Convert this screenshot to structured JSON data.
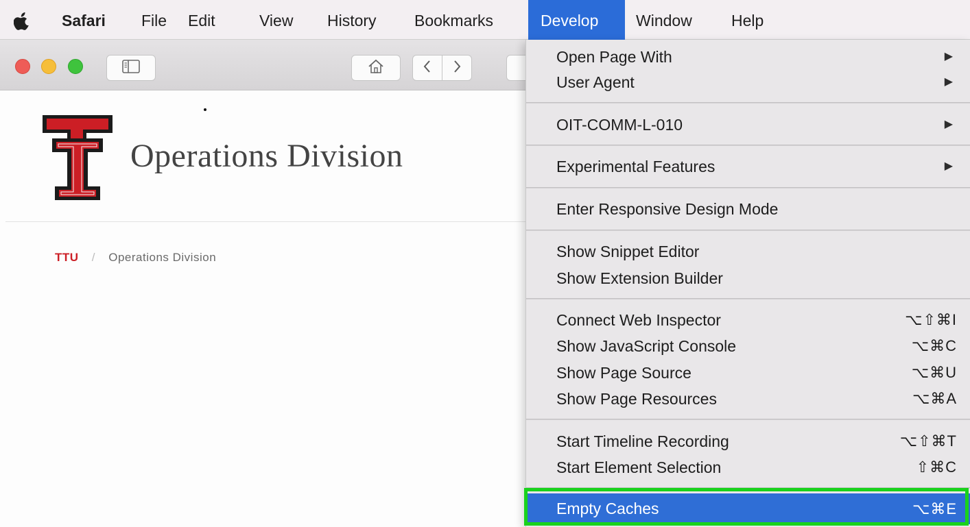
{
  "menubar": {
    "items": [
      "Safari",
      "File",
      "Edit",
      "View",
      "History",
      "Bookmarks",
      "Develop",
      "Window",
      "Help"
    ]
  },
  "page": {
    "title": "Operations Division",
    "breadcrumb": {
      "home": "TTU",
      "separator": "/",
      "current": "Operations Division"
    }
  },
  "develop_menu": {
    "items": [
      {
        "label": "Open Page With",
        "submenu": true
      },
      {
        "label": "User Agent",
        "submenu": true
      },
      {
        "label": "OIT-COMM-L-010",
        "submenu": true
      },
      {
        "label": "Experimental Features",
        "submenu": true
      },
      {
        "label": "Enter Responsive Design Mode"
      },
      {
        "label": "Show Snippet Editor"
      },
      {
        "label": "Show Extension Builder"
      },
      {
        "label": "Connect Web Inspector",
        "shortcut": "⌥⇧⌘I"
      },
      {
        "label": "Show JavaScript Console",
        "shortcut": "⌥⌘C"
      },
      {
        "label": "Show Page Source",
        "shortcut": "⌥⌘U"
      },
      {
        "label": "Show Page Resources",
        "shortcut": "⌥⌘A"
      },
      {
        "label": "Start Timeline Recording",
        "shortcut": "⌥⇧⌘T"
      },
      {
        "label": "Start Element Selection",
        "shortcut": "⇧⌘C"
      },
      {
        "label": "Empty Caches",
        "shortcut": "⌥⌘E",
        "highlighted": true
      }
    ],
    "submenu_arrow": "▶"
  },
  "colors": {
    "menu_highlight": "#2f6ed6",
    "annotation_box": "#19d21c",
    "ttu_red": "#cc1e25"
  },
  "icons": {
    "apple": "apple-icon",
    "sidebar": "sidebar-icon",
    "home": "home-icon",
    "back": "chevron-left-icon",
    "forward": "chevron-right-icon",
    "logo": "texas-tech-double-t-logo"
  }
}
